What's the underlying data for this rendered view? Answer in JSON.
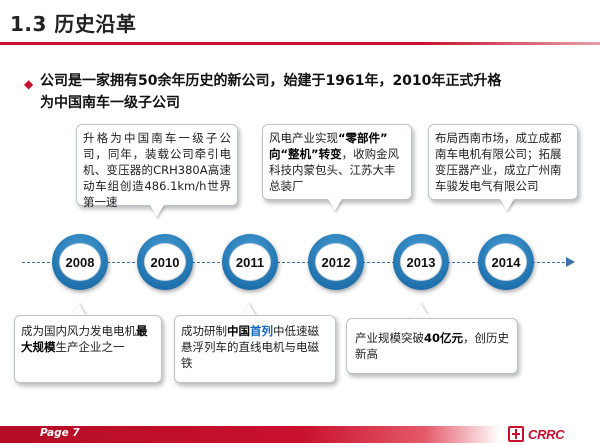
{
  "header": {
    "title": "1.3 历史沿革"
  },
  "summary": {
    "line1": "公司是一家拥有50余年历史的新公司，始建于1961年，2010年正式升格",
    "line2": "为中国南车一级子公司"
  },
  "timeline": {
    "years": [
      "2008",
      "2010",
      "2011",
      "2012",
      "2013",
      "2014"
    ]
  },
  "events": {
    "e2010": {
      "text": "升格为中国南车一级子公司，同年，装载公司牵引电机、变压器的CRH380A高速动车组创造486.1km/h世界第一速"
    },
    "e2012": {
      "pre": "风电产业实现",
      "hl1": "“零部件”",
      "mid": "向",
      "hl2": "“整机”",
      "hl3": "转变",
      "post": "，收购金风科技内蒙包头、江苏大丰总装厂"
    },
    "e2014": {
      "text": "布局西南市场，成立成都南车电机有限公司；拓展变压器产业，成立广州南车骏发电气有限公司"
    },
    "e2008": {
      "pre": "成为国内风力发电电机",
      "hl": "最大规模",
      "post": "生产企业之一"
    },
    "e2011": {
      "pre": "成功研制",
      "hl1": "中国",
      "hl2": "首列",
      "post": "中低速磁悬浮列车的直线电机与电磁铁"
    },
    "e2013": {
      "pre": "产业规模突破",
      "hl": "40亿元",
      "post": "，创历史新高"
    }
  },
  "footer": {
    "page": "Page 7",
    "logo_text": "CRRC"
  },
  "colors": {
    "accent_red": "#c8102e",
    "node_blue": "#0f5f9c",
    "line_blue": "#3e6fa6",
    "highlight_blue": "#1565c0"
  }
}
